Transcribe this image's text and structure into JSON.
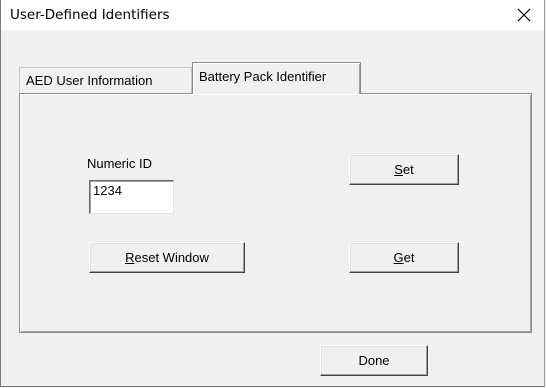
{
  "window": {
    "title": "User-Defined Identifiers",
    "close_glyph": "✕"
  },
  "tabs": [
    {
      "label": "AED User Information",
      "selected": false
    },
    {
      "label": "Battery Pack Identifier",
      "selected": true
    }
  ],
  "panel": {
    "numeric_id_label": "Numeric ID",
    "numeric_id_value": "1234",
    "set_button": {
      "mnemonic": "S",
      "rest": "et"
    },
    "get_button": {
      "mnemonic": "G",
      "rest": "et"
    },
    "reset_button": {
      "mnemonic": "R",
      "rest": "eset Window"
    }
  },
  "footer": {
    "done_label": "Done"
  },
  "icons": {
    "close": "close-icon"
  }
}
